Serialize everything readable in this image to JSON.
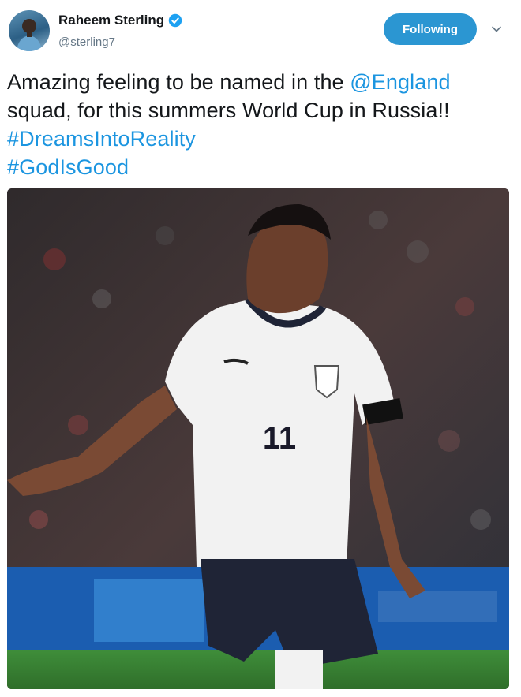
{
  "author": {
    "display_name": "Raheem Sterling",
    "handle": "@sterling7",
    "verified": true
  },
  "follow_button": {
    "label": "Following"
  },
  "menu": {
    "icon": "chevron-down-icon"
  },
  "tweet": {
    "text_1": "Amazing feeling to be named in the ",
    "mention": "@England",
    "text_2": " squad, for this summers  World Cup in Russia!! ",
    "hashtag_1": "#DreamsIntoReality",
    "hashtag_2": "#GodIsGood"
  },
  "photo": {
    "shirt_number": "11"
  },
  "colors": {
    "link": "#1b95e0",
    "button": "#2b96d2",
    "handle": "#657786"
  }
}
